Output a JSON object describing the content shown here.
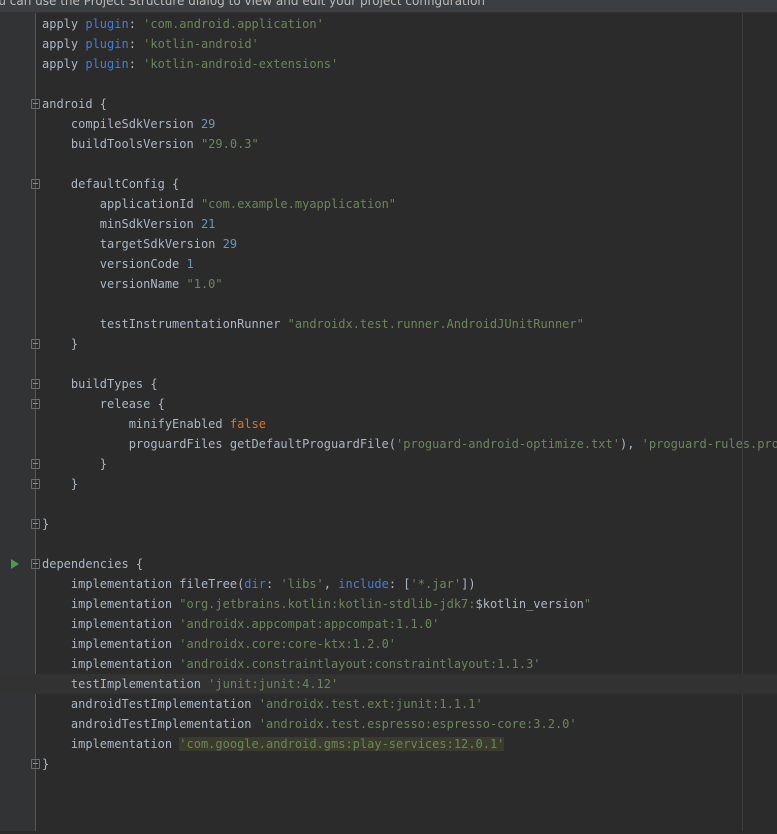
{
  "banner": {
    "text": "ou can use the Project Structure dialog to view and edit your project configuration"
  },
  "code": {
    "l1": [
      "apply ",
      "plugin",
      ": ",
      "'com.android.application'"
    ],
    "l2": [
      "apply ",
      "plugin",
      ": ",
      "'kotlin-android'"
    ],
    "l3": [
      "apply ",
      "plugin",
      ": ",
      "'kotlin-android-extensions'"
    ],
    "l5": "android {",
    "l6": [
      "    compileSdkVersion ",
      "29"
    ],
    "l7": [
      "    buildToolsVersion ",
      "\"29.0.3\""
    ],
    "l9": "    defaultConfig {",
    "l10": [
      "        applicationId ",
      "\"com.example.myapplication\""
    ],
    "l11": [
      "        minSdkVersion ",
      "21"
    ],
    "l12": [
      "        targetSdkVersion ",
      "29"
    ],
    "l13": [
      "        versionCode ",
      "1"
    ],
    "l14": [
      "        versionName ",
      "\"1.0\""
    ],
    "l16": [
      "        testInstrumentationRunner ",
      "\"androidx.test.runner.AndroidJUnitRunner\""
    ],
    "l17": "    }",
    "l19": "    buildTypes {",
    "l20": "        release {",
    "l21": [
      "            minifyEnabled ",
      "false"
    ],
    "l22": [
      "            proguardFiles getDefaultProguardFile(",
      "'proguard-android-optimize.txt'",
      "), ",
      "'proguard-rules.pro'"
    ],
    "l23": "        }",
    "l24": "    }",
    "l26": "}",
    "l28": "dependencies {",
    "l29": [
      "    implementation fileTree(",
      "dir",
      ": ",
      "'libs'",
      ", ",
      "include",
      ": [",
      "'*.jar'",
      "])"
    ],
    "l30": [
      "    implementation ",
      "\"org.jetbrains.kotlin:kotlin-stdlib-jdk7:",
      "$kotlin_version",
      "\""
    ],
    "l31": [
      "    implementation ",
      "'androidx.appcompat:appcompat:1.1.0'"
    ],
    "l32": [
      "    implementation ",
      "'androidx.core:core-ktx:1.2.0'"
    ],
    "l33": [
      "    implementation ",
      "'androidx.constraintlayout:constraintlayout:1.1.3'"
    ],
    "l34": [
      "    testImplementation ",
      "'junit:junit:4.12'"
    ],
    "l35": [
      "    androidTestImplementation ",
      "'androidx.test.ext:junit:1.1.1'"
    ],
    "l36": [
      "    androidTestImplementation ",
      "'androidx.test.espresso:espresso-core:3.2.0'"
    ],
    "l37": [
      "    implementation ",
      "'com.google.android.gms:play-services:12.0.1'"
    ],
    "l38": "}"
  },
  "colors": {
    "background": "#2b2b2b",
    "gutter": "#313335",
    "string": "#6a8759",
    "number": "#6897bb",
    "keyword": "#cc7832",
    "named_param": "#467cda",
    "run_icon": "#499c54",
    "bulb_icon": "#f0a732"
  },
  "icons": {
    "run": "run-gutter-icon",
    "bulb": "lightbulb-icon",
    "fold": "fold-icon"
  }
}
